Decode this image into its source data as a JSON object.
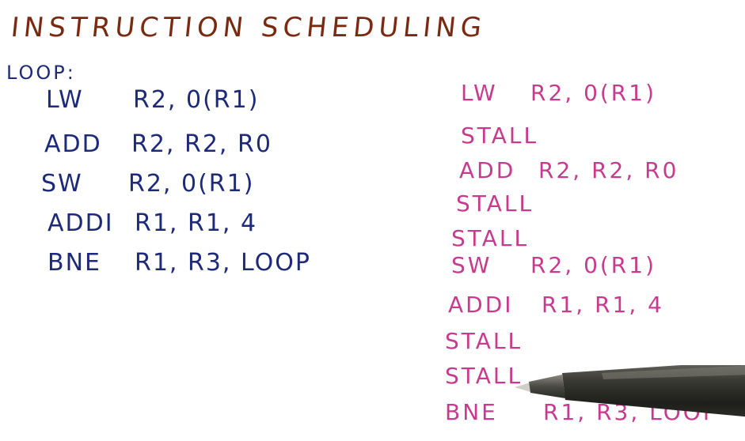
{
  "title": "INSTRUCTION SCHEDULING",
  "loop_label": "LOOP:",
  "original_code": [
    {
      "op": "LW",
      "args": "R2, 0(R1)"
    },
    {
      "op": "ADD",
      "args": "R2, R2, R0"
    },
    {
      "op": "SW",
      "args": "R2, 0(R1)"
    },
    {
      "op": "ADDI",
      "args": "R1, R1, 4"
    },
    {
      "op": "BNE",
      "args": "R1, R3, LOOP"
    }
  ],
  "scheduled_code": [
    {
      "op": "LW",
      "args": "R2, 0(R1)"
    },
    {
      "op": "STALL",
      "args": ""
    },
    {
      "op": "ADD",
      "args": "R2, R2, R0"
    },
    {
      "op": "STALL",
      "args": ""
    },
    {
      "op": "STALL",
      "args": ""
    },
    {
      "op": "SW",
      "args": "R2, 0(R1)"
    },
    {
      "op": "ADDI",
      "args": "R1, R1, 4"
    },
    {
      "op": "STALL",
      "args": ""
    },
    {
      "op": "STALL",
      "args": ""
    },
    {
      "op": "BNE",
      "args": "R1, R3, LOOP"
    }
  ],
  "colors": {
    "title": "#7a2a10",
    "original_code": "#1d2a7a",
    "scheduled_code": "#c83a8e",
    "background": "#ffffff"
  },
  "icons": {
    "pen": "stylus-pen-icon"
  }
}
